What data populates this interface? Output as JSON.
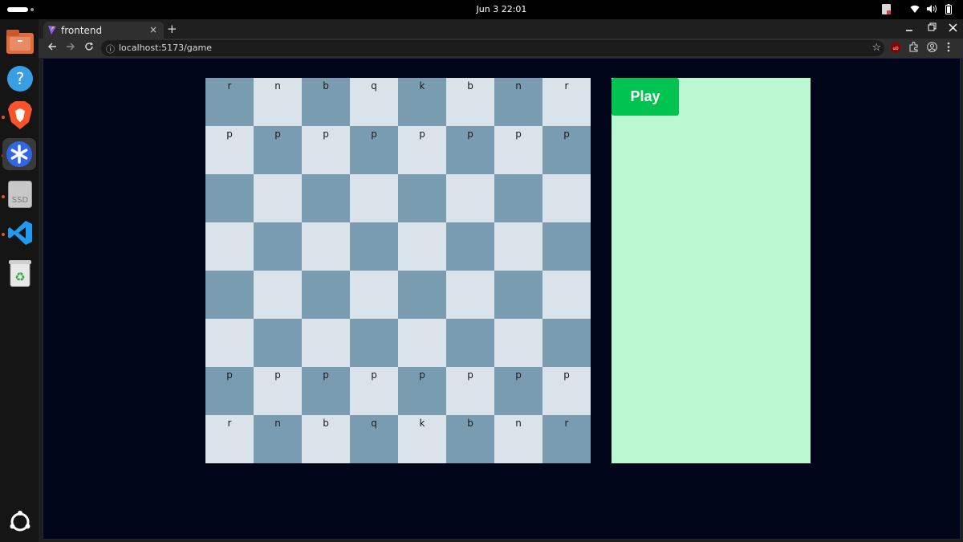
{
  "topbar": {
    "clock": "Jun 3  22:01"
  },
  "dock": {
    "apps": [
      {
        "name": "files",
        "running": false
      },
      {
        "name": "help",
        "running": false
      },
      {
        "name": "brave",
        "running": true
      },
      {
        "name": "asterisk-app",
        "running": true
      },
      {
        "name": "ssd-drive",
        "running": true
      },
      {
        "name": "vscode",
        "running": true
      },
      {
        "name": "trash",
        "running": false
      }
    ],
    "ssd_label": "SSD"
  },
  "browser": {
    "tab_title": "frontend",
    "tab_close": "×",
    "new_tab": "+",
    "url": "localhost:5173/game"
  },
  "board": {
    "light_color": "#dbe3ea",
    "dark_color": "#7a9cb1",
    "rows": [
      [
        "r",
        "n",
        "b",
        "q",
        "k",
        "b",
        "n",
        "r"
      ],
      [
        "p",
        "p",
        "p",
        "p",
        "p",
        "p",
        "p",
        "p"
      ],
      [
        "",
        "",
        "",
        "",
        "",
        "",
        "",
        ""
      ],
      [
        "",
        "",
        "",
        "",
        "",
        "",
        "",
        ""
      ],
      [
        "",
        "",
        "",
        "",
        "",
        "",
        "",
        ""
      ],
      [
        "",
        "",
        "",
        "",
        "",
        "",
        "",
        ""
      ],
      [
        "p",
        "p",
        "p",
        "p",
        "p",
        "p",
        "p",
        "p"
      ],
      [
        "r",
        "n",
        "b",
        "q",
        "k",
        "b",
        "n",
        "r"
      ]
    ]
  },
  "panel": {
    "play_label": "Play",
    "background": "#bbf7d0",
    "button_color": "#00c352"
  }
}
